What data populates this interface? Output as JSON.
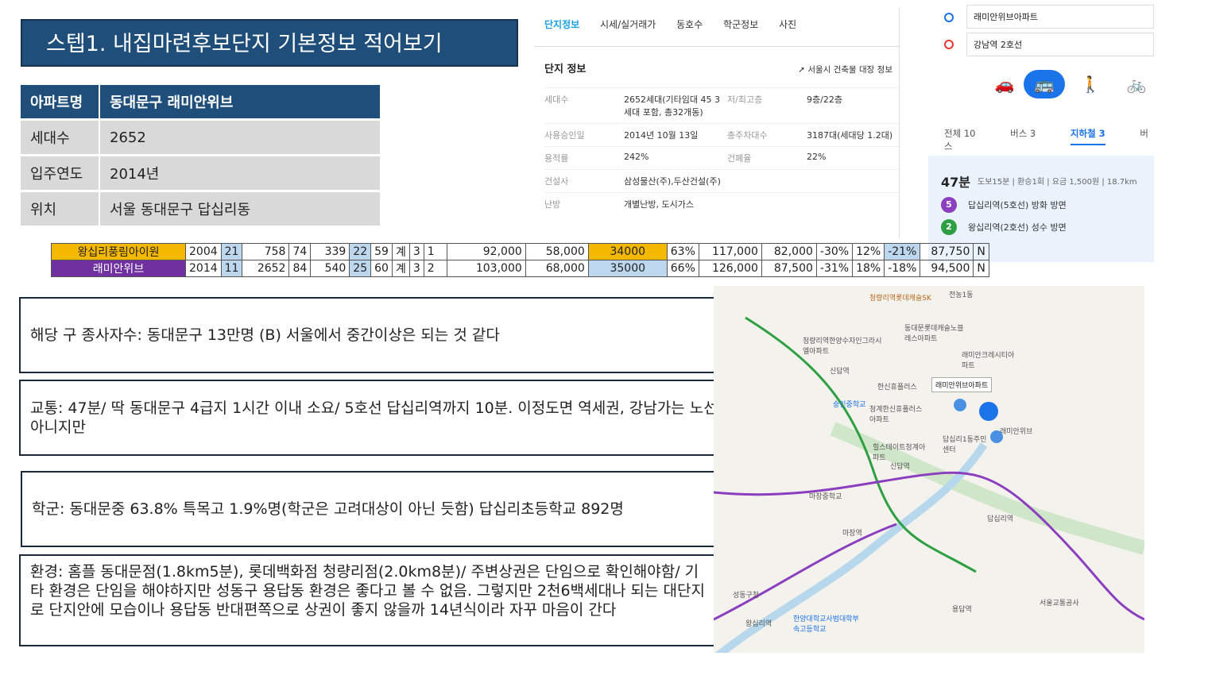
{
  "title": "스텝1. 내집마련후보단지 기본정보 적어보기",
  "info_table": {
    "header": {
      "key": "아파트명",
      "value": "동대문구 래미안위브"
    },
    "rows": [
      {
        "key": "세대수",
        "value": "2652"
      },
      {
        "key": "입주연도",
        "value": "2014년"
      },
      {
        "key": "위치",
        "value": "서울 동대문구 답십리동"
      }
    ]
  },
  "naver": {
    "tabs": [
      "단지정보",
      "시세/실거래가",
      "동호수",
      "학군정보",
      "사진"
    ],
    "section_title": "단지 정보",
    "link": "서울시 건축물 대장 정보",
    "rows": [
      {
        "k1": "세대수",
        "v1": "2652세대(기타임대 45 3세대 포함, 총32개동)",
        "k2": "저/최고층",
        "v2": "9층/22층"
      },
      {
        "k1": "사용승인일",
        "v1": "2014년 10월 13일",
        "k2": "총주차대수",
        "v2": "3187대(세대당 1.2대)"
      },
      {
        "k1": "용적률",
        "v1": "242%",
        "k2": "건폐율",
        "v2": "22%"
      },
      {
        "k1": "건설사",
        "v1": "삼성물산(주),두산건설(주)",
        "k2": "",
        "v2": ""
      },
      {
        "k1": "난방",
        "v1": "개별난방, 도시가스",
        "k2": "",
        "v2": ""
      }
    ]
  },
  "directions": {
    "origin": "래미안위브아파트",
    "destination": "강남역 2호선",
    "modes": [
      "car-icon",
      "bus-icon",
      "walk-icon",
      "bike-icon"
    ],
    "tabs": [
      "전체 10",
      "버스 3",
      "지하철 3",
      "버스"
    ],
    "time": "47분",
    "detail": "도보15분 | 환승1회 | 요금 1,500원 | 18.7km",
    "stops": [
      {
        "line": "5",
        "color": "#8b3fbf",
        "text": "답십리역(5호선) 방화 방면"
      },
      {
        "line": "2",
        "color": "#2ea043",
        "text": "왕십리역(2호선) 성수 방면"
      }
    ]
  },
  "comparison": {
    "rows": [
      [
        "왕십리풍림아이원",
        "2004",
        "21",
        "758",
        "74",
        "339",
        "22",
        "59",
        "계",
        "3",
        "1",
        "92,000",
        "58,000",
        "34000",
        "63%",
        "117,000",
        "82,000",
        "-30%",
        "12%",
        "-21%",
        "87,750",
        "N"
      ],
      [
        "래미안위브",
        "2014",
        "11",
        "2652",
        "84",
        "540",
        "25",
        "60",
        "계",
        "3",
        "2",
        "103,000",
        "68,000",
        "35000",
        "66%",
        "126,000",
        "87,500",
        "-31%",
        "18%",
        "-18%",
        "94,500",
        "N"
      ]
    ]
  },
  "notes": {
    "employment": "해당 구 종사자수: 동대문구 13만명 (B)  서울에서 중간이상은 되는 것 같다",
    "transport": "교통: 47분/ 딱 동대문구 4급지 1시간 이내 소요/ 5호선 답십리역까지 10분. 이정도면 역세권, 강남가는 노선은 아니지만",
    "school": "학군: 동대문중 63.8% 특목고 1.9%명(학군은 고려대상이 아닌 듯함)  답십리초등학교 892명",
    "environment": "환경: 홈플 동대문점(1.8km5분), 롯데백화점 청량리점(2.0km8분)/ 주변상권은 단임으로 확인해야함/ 기타 환경은 단임을 해야하지만 성동구 용답동 환경은 좋다고 볼 수 없음.  그렇지만 2천6백세대나 되는 대단지로 단지안에 모습이나 용답동 반대편쪽으로 상권이 좋지 않을까 14년식이라 자꾸 마음이 간다"
  },
  "map": {
    "popup": "래미안위브아파트",
    "labels": [
      "청량리역롯데캐슬SK",
      "전농1동",
      "동대문롯데캐슬노블레스아파트",
      "청량리역한양수자인그라시엘아파트",
      "래미안크레시티아파트",
      "신답역",
      "한신휴플러스",
      "숭인중학교",
      "답십리1동주민센터",
      "마장역",
      "왕십리역",
      "용답역",
      "답십리역",
      "성동구청",
      "한양대학교사범대학부속고등학교",
      "서울교통공사",
      "청계한신휴플러스아파트",
      "힐스테이트청계아파트",
      "신답역",
      "마장중학교",
      "래미안위브"
    ]
  }
}
